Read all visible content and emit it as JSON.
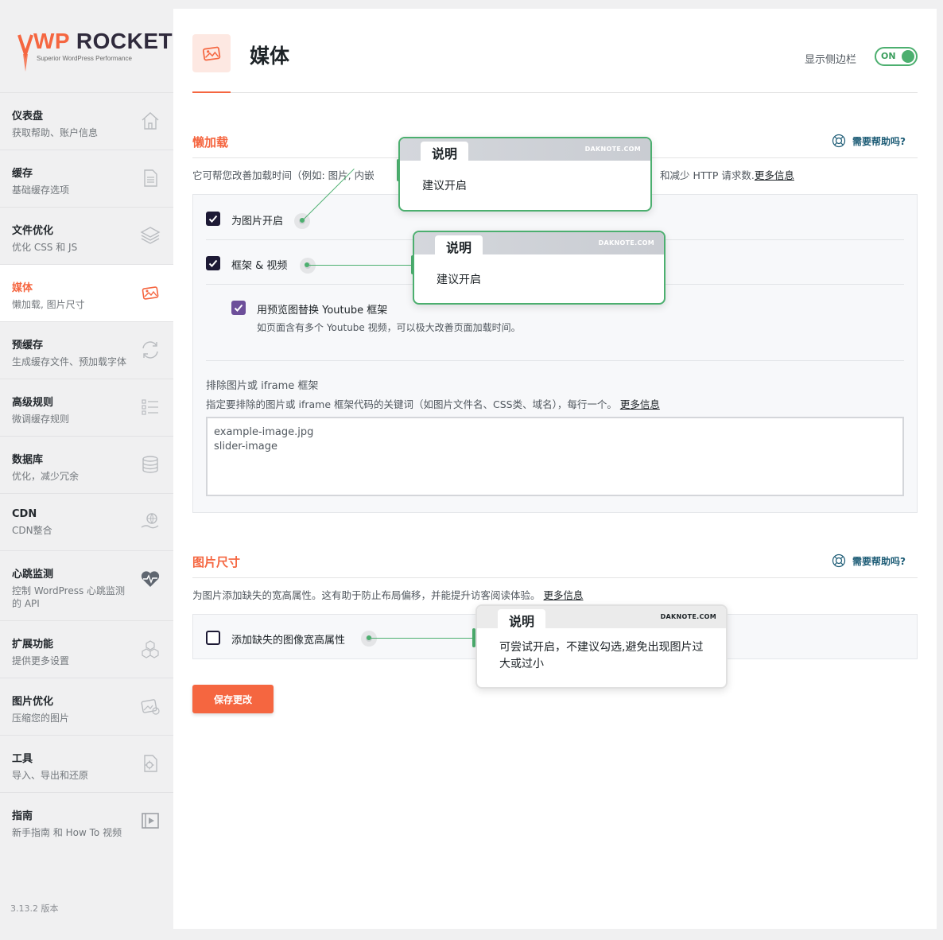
{
  "brand": {
    "logo_wp": "WP",
    "logo_rocket": "ROCKET",
    "tagline": "Superior WordPress Performance",
    "accent": "#f56640"
  },
  "sidebar": {
    "items": [
      {
        "title": "仪表盘",
        "sub": "获取帮助、账户信息",
        "icon": "home-icon"
      },
      {
        "title": "缓存",
        "sub": "基础缓存选项",
        "icon": "file-icon"
      },
      {
        "title": "文件优化",
        "sub": "优化 CSS 和 JS",
        "icon": "layers-icon"
      },
      {
        "title": "媒体",
        "sub": "懒加载, 图片尺寸",
        "icon": "images-icon"
      },
      {
        "title": "预缓存",
        "sub": "生成缓存文件、预加载字体",
        "icon": "refresh-icon"
      },
      {
        "title": "高级规则",
        "sub": "微调缓存规则",
        "icon": "list-icon"
      },
      {
        "title": "数据库",
        "sub": "优化，减少冗余",
        "icon": "database-icon"
      },
      {
        "title": "CDN",
        "sub": "CDN整合",
        "icon": "globe-hand-icon"
      },
      {
        "title": "心跳监测",
        "sub": "控制 WordPress 心跳监测",
        "sub2": "的 API",
        "icon": "heartbeat-icon"
      },
      {
        "title": "扩展功能",
        "sub": "提供更多设置",
        "icon": "cubes-icon"
      },
      {
        "title": "图片优化",
        "sub": "压缩您的图片",
        "icon": "image-optimize-icon"
      },
      {
        "title": "工具",
        "sub": "导入、导出和还原",
        "icon": "tools-icon"
      },
      {
        "title": "指南",
        "sub": "新手指南 和 How To 视频",
        "icon": "video-icon"
      }
    ],
    "version": "3.13.2 版本"
  },
  "header": {
    "title": "媒体",
    "sidebar_toggle_label": "显示侧边栏",
    "toggle_state": "ON"
  },
  "lazyload": {
    "title": "懒加载",
    "help": "需要帮助吗?",
    "desc_start": "它可帮您改善加载时间（例如: 图片, 内嵌",
    "desc_end": "和减少 HTTP 请求数.",
    "more": "更多信息",
    "opt_images": "为图片开启",
    "opt_iframes": "框架 & 视频",
    "opt_youtube": "用预览图替换 Youtube 框架",
    "opt_youtube_sub": "如页面含有多个 Youtube 视频，可以极大改善页面加载时间。",
    "exclude_title": "排除图片或 iframe 框架",
    "exclude_desc": "指定要排除的图片或 iframe 框架代码的关键词（如图片文件名、CSS类、域名），每行一个。",
    "exclude_more": "更多信息",
    "exclude_value": "example-image.jpg\nslider-image"
  },
  "dimensions": {
    "title": "图片尺寸",
    "help": "需要帮助吗?",
    "desc": "为图片添加缺失的宽高属性。这有助于防止布局偏移，并能提升访客阅读体验。",
    "more": "更多信息",
    "opt_dimensions": "添加缺失的图像宽高属性"
  },
  "save_button": "保存更改",
  "callouts": [
    {
      "tab": "说明",
      "brand": "DAKNOTE.COM",
      "body": "建议开启"
    },
    {
      "tab": "说明",
      "brand": "DAKNOTE.COM",
      "body": "建议开启"
    },
    {
      "tab": "说明",
      "brand": "DAKNOTE.COM",
      "body": "可尝试开启，不建议勾选,避免出现图片过大或过小"
    }
  ]
}
